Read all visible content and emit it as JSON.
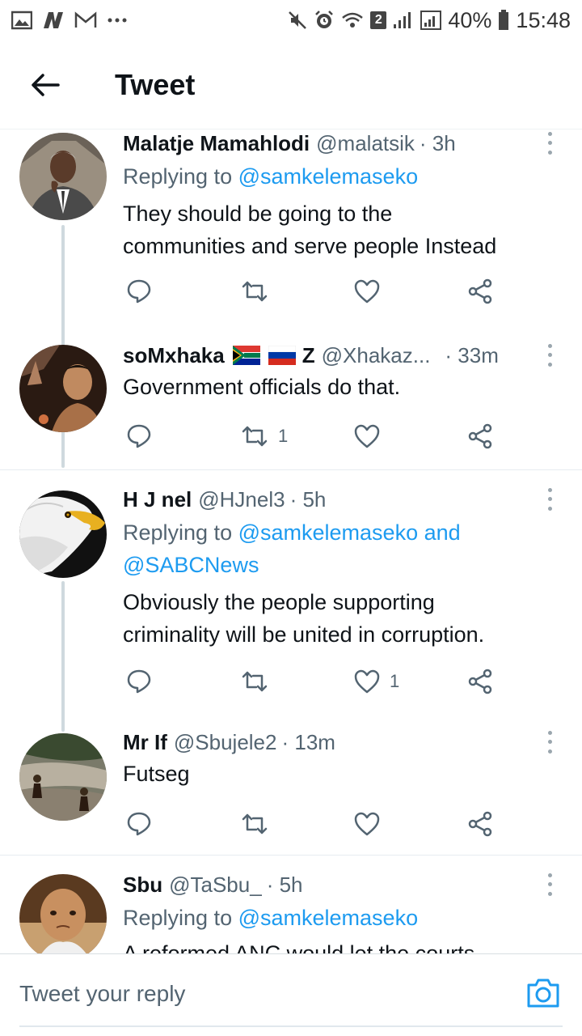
{
  "status_bar": {
    "battery_percent": "40%",
    "time": "15:48",
    "sim_badge": "2",
    "left_icons": [
      "gallery-icon",
      "n-logo-icon",
      "mail-icon",
      "more-dots-icon"
    ],
    "right_icons": [
      "mute-icon",
      "alarm-icon",
      "wifi-icon",
      "signal-icon",
      "signal-icon",
      "battery-icon"
    ]
  },
  "header": {
    "title": "Tweet",
    "back_icon": "arrow-left-icon"
  },
  "tweets": [
    {
      "name": "Malatje Mamahlodi",
      "handle": "@malatsik",
      "time": "· 3h",
      "reply_prefix": "Replying to ",
      "reply_mentions": "@samkelemaseko",
      "text_lines": [
        "They should be going to the",
        "communities and serve people Instead"
      ],
      "retweets": "",
      "likes": ""
    },
    {
      "name": "soMxhaka",
      "name_suffix": "Z",
      "handle": "@Xhakaz...",
      "time": "· 33m",
      "text_lines": [
        "Government officials do that."
      ],
      "retweets": "1",
      "likes": ""
    },
    {
      "name": "H J nel",
      "handle": "@HJnel3",
      "time": "· 5h",
      "reply_prefix": "Replying to ",
      "reply_mentions": "@samkelemaseko and",
      "reply_mentions_2": "@SABCNews",
      "text_lines": [
        "Obviously the people supporting",
        "criminality will be united in corruption."
      ],
      "retweets": "",
      "likes": "1"
    },
    {
      "name": "Mr If",
      "handle": "@Sbujele2",
      "time": "· 13m",
      "text_lines": [
        "Futseg"
      ],
      "retweets": "",
      "likes": ""
    },
    {
      "name": "Sbu",
      "handle": "@TaSbu_",
      "time": "· 5h",
      "reply_prefix": "Replying to ",
      "reply_mentions": "@samkelemaseko",
      "text_lines": [
        "A reformed ANC would let the courts"
      ]
    }
  ],
  "composer": {
    "placeholder": "Tweet your reply",
    "camera_icon": "camera-icon"
  },
  "colors": {
    "accent": "#1d9bf0",
    "text": "#0f1419",
    "secondary": "#536471",
    "thread_line": "#cfd9de"
  }
}
